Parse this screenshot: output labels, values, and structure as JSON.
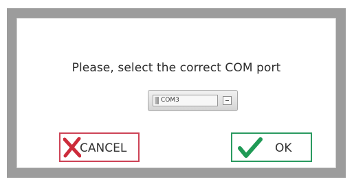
{
  "dialog": {
    "prompt": "Please, select the correct COM port"
  },
  "com_select": {
    "value": "COM3"
  },
  "buttons": {
    "cancel_label": "CANCEL",
    "ok_label": "OK"
  },
  "colors": {
    "cancel_accent": "#cd2b3a",
    "ok_accent": "#1f9a55"
  },
  "icons": {
    "cancel": "x-mark-icon",
    "ok": "check-mark-icon"
  }
}
